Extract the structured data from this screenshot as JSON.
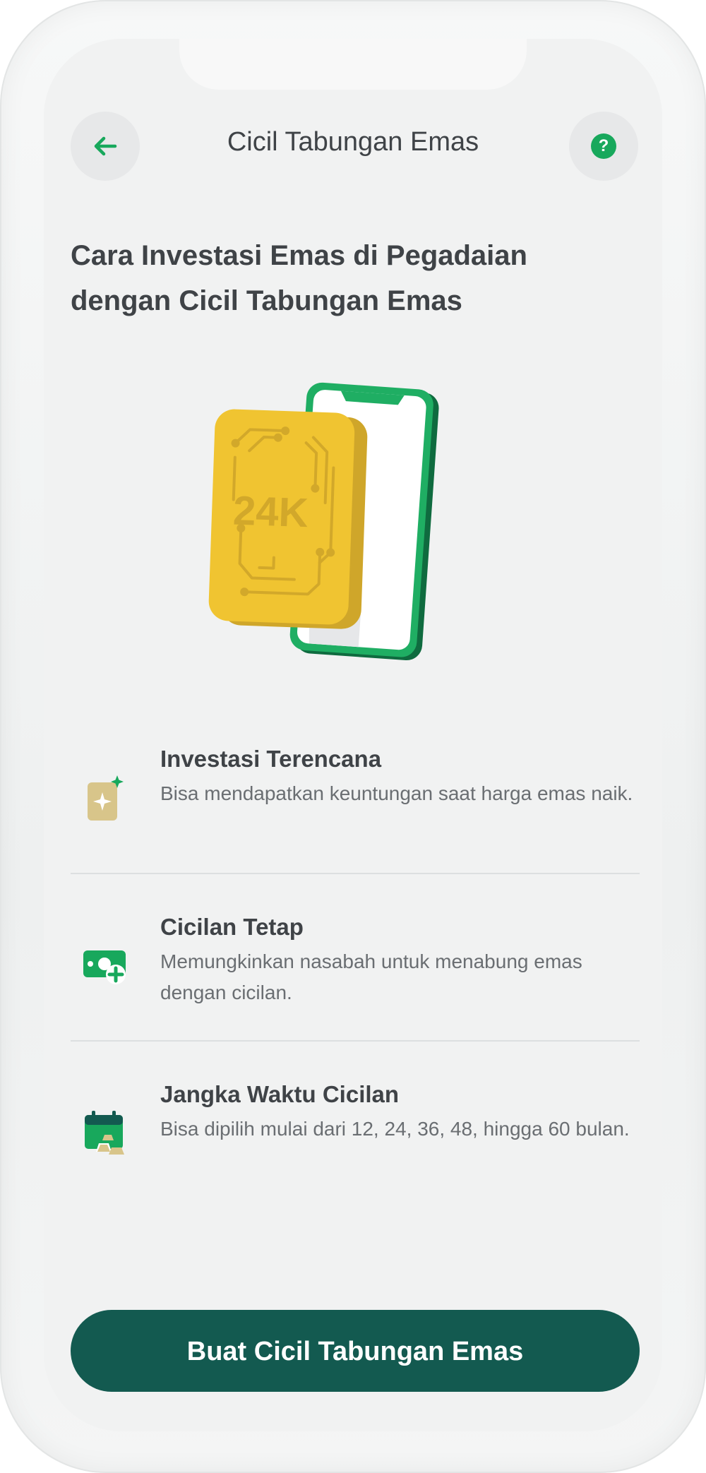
{
  "header": {
    "title": "Cicil Tabungan Emas",
    "back_icon": "arrow-left-icon",
    "help_icon": "question-mark-icon",
    "help_label": "?"
  },
  "headline": "Cara Investasi Emas di Pegadaian dengan Cicil Tabungan Emas",
  "hero": {
    "karat_label": "24K"
  },
  "features": [
    {
      "icon": "gold-sparkle-icon",
      "title": "Investasi Terencana",
      "description": "Bisa mendapatkan keuntungan saat harga emas naik."
    },
    {
      "icon": "money-add-icon",
      "title": "Cicilan Tetap",
      "description": "Memungkinkan nasabah untuk menabung emas dengan cicilan."
    },
    {
      "icon": "calendar-gold-icon",
      "title": "Jangka Waktu Cicilan",
      "description": "Bisa dipilih mulai dari 12, 24, 36, 48, hingga 60 bulan."
    }
  ],
  "cta": {
    "label": "Buat Cicil Tabungan Emas"
  },
  "colors": {
    "brand_green": "#18a85c",
    "cta_bg": "#135a50",
    "gold": "#f0c431"
  }
}
